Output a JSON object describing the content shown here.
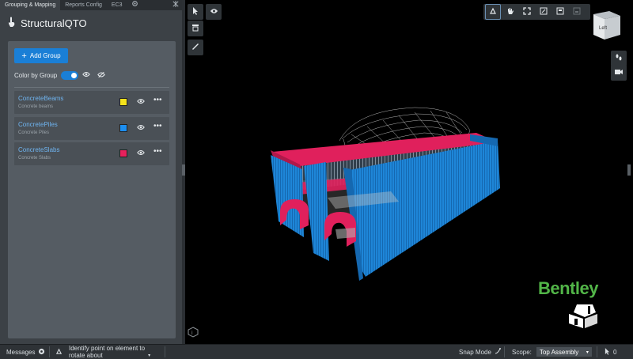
{
  "tabs": [
    {
      "label": "Grouping & Mapping"
    },
    {
      "label": "Reports Config"
    },
    {
      "label": "EC3"
    }
  ],
  "panel": {
    "title": "StructuralQTO",
    "add_group_label": "Add Group",
    "color_by_group_label": "Color by Group",
    "color_by_group_enabled": true,
    "groups": [
      {
        "name": "ConcreteBeams",
        "description": "Concrete beams",
        "color": "#f5e21b"
      },
      {
        "name": "ConcretePiles",
        "description": "Concrete Piles",
        "color": "#1c8ef0"
      },
      {
        "name": "ConcreteSlabs",
        "description": "Concrete Slabs",
        "color": "#e8205c"
      }
    ]
  },
  "viewport": {
    "brand": "Bentley",
    "view_cube_face": "Left"
  },
  "statusbar": {
    "messages_label": "Messages",
    "prompt_line1": "Identify point on element to",
    "prompt_line2": "rotate about",
    "snap_mode_label": "Snap Mode",
    "scope_label": "Scope:",
    "scope_value": "Top Assembly",
    "selection_count": "0"
  },
  "colors": {
    "accent": "#1a7fd6",
    "brand_green": "#52b548",
    "model_blue": "#1e86d8",
    "model_red": "#e0205c"
  }
}
